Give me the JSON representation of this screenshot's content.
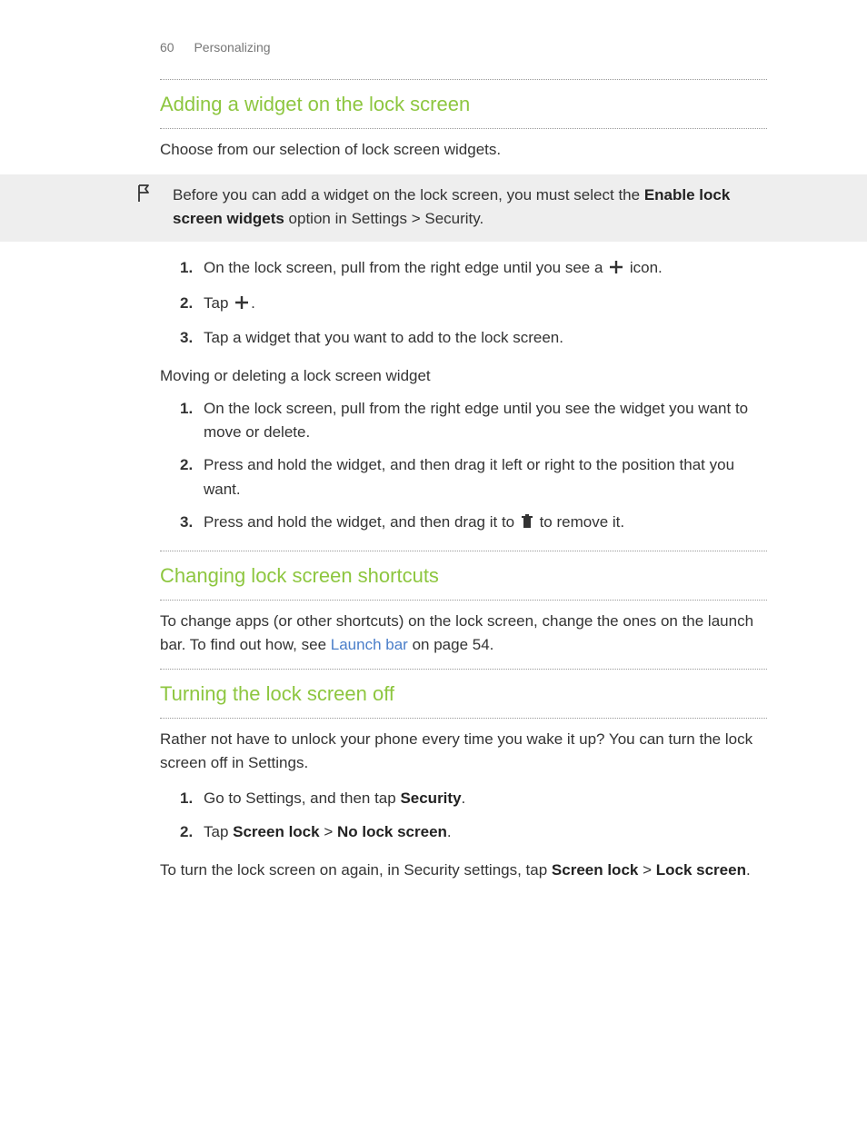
{
  "header": {
    "page_number": "60",
    "section": "Personalizing"
  },
  "sec1": {
    "title": "Adding a widget on the lock screen",
    "intro": "Choose from our selection of lock screen widgets.",
    "note_pref": "Before you can add a widget on the lock screen, you must select the ",
    "note_bold": "Enable lock screen widgets",
    "note_mid": " option in ",
    "note_s1": "Settings",
    "note_gt": " > ",
    "note_s2": "Security",
    "note_end": ".",
    "step1_a": "On the lock screen, pull from the right edge until you see a ",
    "step1_b": " icon.",
    "step2_a": "Tap ",
    "step2_b": ".",
    "step3": "Tap a widget that you want to add to the lock screen.",
    "sub": "Moving or deleting a lock screen widget",
    "m1": "On the lock screen, pull from the right edge until you see the widget you want to move or delete.",
    "m2": "Press and hold the widget, and then drag it left or right to the position that you want.",
    "m3_a": "Press and hold the widget, and then drag it to ",
    "m3_b": " to remove it."
  },
  "sec2": {
    "title": "Changing lock screen shortcuts",
    "p_a": "To change apps (or other shortcuts) on the lock screen, change the ones on the launch bar. To find out how, see ",
    "link": "Launch bar",
    "p_b": " on page 54."
  },
  "sec3": {
    "title": "Turning the lock screen off",
    "intro": "Rather not have to unlock your phone every time you wake it up? You can turn the lock screen off in Settings.",
    "s1_a": "Go to Settings, and then tap ",
    "s1_b": "Security",
    "s1_c": ".",
    "s2_a": "Tap ",
    "s2_b": "Screen lock",
    "s2_gt": " > ",
    "s2_c": "No lock screen",
    "s2_d": ".",
    "end_a": "To turn the lock screen on again, in Security settings, tap ",
    "end_b": "Screen lock",
    "end_gt": " > ",
    "end_c": "Lock screen",
    "end_d": "."
  }
}
